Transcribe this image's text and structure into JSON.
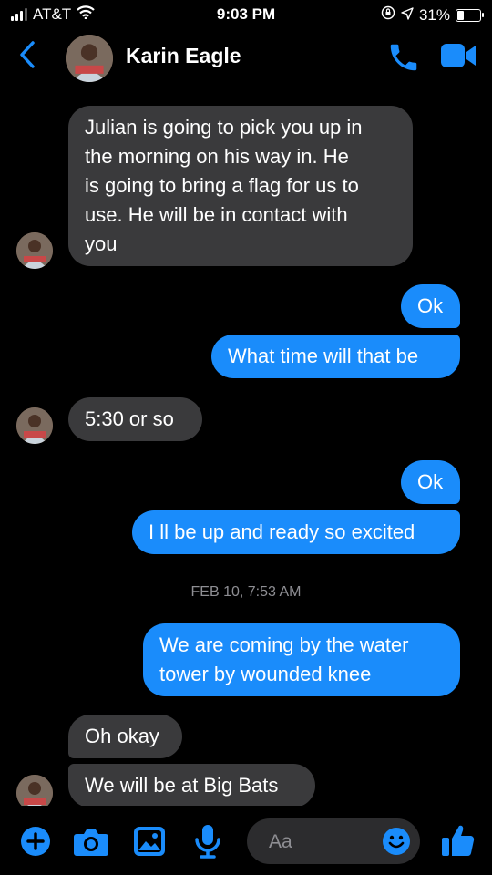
{
  "status_bar": {
    "carrier": "AT&T",
    "time": "9:03 PM",
    "battery_percent": "31%",
    "battery_level": 0.31,
    "icons": [
      "signal-icon",
      "wifi-icon",
      "orientation-lock-icon",
      "location-arrow-icon",
      "battery-icon"
    ]
  },
  "header": {
    "contact_name": "Karin Eagle",
    "icons": [
      "back-chevron-icon",
      "phone-icon",
      "video-camera-icon"
    ]
  },
  "messages": [
    {
      "direction": "incoming",
      "lines": [
        "Julian is going to pick you up in",
        "the morning on his way in. He",
        "is going to bring a flag for us to",
        "use. He will be in contact with",
        "you"
      ]
    },
    {
      "direction": "outgoing",
      "text": "Ok"
    },
    {
      "direction": "outgoing",
      "text": "What time will that be"
    },
    {
      "direction": "incoming",
      "text": "5:30 or so"
    },
    {
      "direction": "outgoing",
      "text": "Ok"
    },
    {
      "direction": "outgoing",
      "text": "I ll be up and ready so excited"
    },
    {
      "direction": "outgoing",
      "lines": [
        "We are coming by the water",
        "tower by wounded knee"
      ]
    },
    {
      "direction": "incoming",
      "text": "Oh okay"
    },
    {
      "direction": "incoming",
      "text": "We will be at Big Bats"
    }
  ],
  "timestamp_divider": "FEB 10, 7:53 AM",
  "composer": {
    "placeholder": "Aa",
    "icons": [
      "plus-icon",
      "camera-icon",
      "photo-icon",
      "microphone-icon",
      "emoji-icon",
      "thumbs-up-icon"
    ]
  },
  "colors": {
    "accent": "#1a8cfb",
    "incoming_bubble": "#3a3a3c",
    "background": "#000000",
    "divider_text": "#8e8e93"
  }
}
